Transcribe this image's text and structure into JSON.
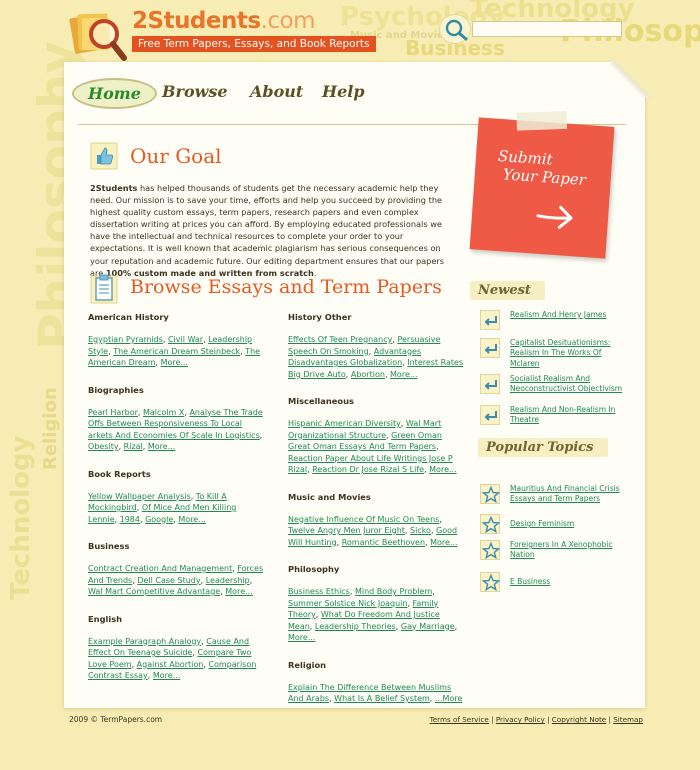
{
  "brand": {
    "name": "2Students",
    "suffix": ".com",
    "tagline": "Free Term Papers, Essays, and Book Reports"
  },
  "search": {
    "value": "",
    "placeholder": ""
  },
  "nav": [
    {
      "label": "Home",
      "active": true
    },
    {
      "label": "Browse"
    },
    {
      "label": "About"
    },
    {
      "label": "Help"
    }
  ],
  "background_words": [
    "Psychology",
    "Technology",
    "Philosophy",
    "Business",
    "Music and Movies",
    "Philosophy",
    "Technology",
    "Religion"
  ],
  "goal": {
    "title": "Our Goal",
    "brand_bold": "2Students",
    "text1": " has helped thousands of students get the necessary academic help they need. Our mission is to save your time, efforts and help you succeed by providing the highest quality custom essays, term papers, research papers and even complex dissertation writing at prices you can afford. By employing educated professionals we have the intellectual and technical resources to complete your order to your expectations. It is well known that academic plagiarism has serious consequences on your reputation and academic future. Our editing department ensures that our papers are ",
    "bold2": "100% custom made and written from scratch",
    "text2": "."
  },
  "browse": {
    "title": "Browse Essays and Term Papers",
    "left": [
      {
        "heading": "American History",
        "links": [
          "Egyptian Pyramids",
          "Civil War",
          "Leadership Style",
          "The American Dream Steinbeck",
          "The American Dream"
        ],
        "more": "More..."
      },
      {
        "heading": "Biographies",
        "links": [
          "Pearl Harbor",
          "Malcolm X",
          "Analyse The Trade Offs Between Responsiveness To Local arkets And Economies Of Scale In Logistics",
          "Obesity",
          "Rizal"
        ],
        "more": "More..."
      },
      {
        "heading": "Book Reports",
        "links": [
          "Yellow Wallpaper Analysis",
          "To Kill A Mockingbird",
          "Of Mice And Men Killing Lennie",
          "1984",
          "Google"
        ],
        "more": "More..."
      },
      {
        "heading": "Business",
        "links": [
          "Contract Creation And Management",
          "Forces And Trends",
          "Dell Case Study",
          "Leadership",
          "Wal Mart Competitive Advantage"
        ],
        "more": "More..."
      },
      {
        "heading": "English",
        "links": [
          "Example Paragraph Analogy",
          "Cause And Effect On Teenage Suicide",
          "Compare Two Love Poem",
          "Against Abortion",
          "Comparison Contrast Essay"
        ],
        "more": "More..."
      }
    ],
    "right": [
      {
        "heading": "History Other",
        "links": [
          "Effects Of Teen Pregnancy",
          "Persuasive Speech On Smoking",
          "Advantages Disadvantages Globalization",
          "Interest Rates Big Drive Auto",
          "Abortion"
        ],
        "more": "More..."
      },
      {
        "heading": "Miscellaneous",
        "links": [
          "Hispanic American Diversity",
          "Wal Mart Organizational Structure",
          "Green Oman Great Oman Essays And Term Papers",
          "Reaction Paper About Life Writings Jose P Rizal",
          "Reaction Dr Jose Rizal S Life"
        ],
        "more": "More..."
      },
      {
        "heading": "Music and Movies",
        "links": [
          "Negative Influence Of Music On Teens",
          "Twelve Angry Men Juror Eight",
          "Sicko",
          "Good Will Hunting",
          "Romantic Beethoven"
        ],
        "more": "More..."
      },
      {
        "heading": "Philosophy",
        "links": [
          "Business Ethics",
          "Mind Body Problem",
          "Summer Solstice Nick Joaquin",
          "Family Theory",
          "What Do Freedom And Justice Mean",
          "Leadership Theories",
          "Gay Marriage"
        ],
        "more": "More..."
      },
      {
        "heading": "Religion",
        "links": [
          "Explain The Difference Between Muslims And Arabs",
          "What Is A Belief System"
        ],
        "more": "...More"
      }
    ]
  },
  "submit": {
    "line1": "Submit",
    "line2": "Your Paper"
  },
  "newest": {
    "title": "Newest",
    "items": [
      "Realism And Henry James",
      "Capitalist Desituationisms: Realism In The Works Of Mclaren",
      "Socialist Realism And Neoconstructivist Objectivism",
      "Realism And Non-Realism In Theatre"
    ]
  },
  "popular": {
    "title": "Popular Topics",
    "items": [
      "Mauritius And Financial Crisis Essays and Term Papers",
      "Design Feminism",
      "Foreigners In A Xenophobic Nation",
      "E Business"
    ]
  },
  "footer": {
    "copyright": "2009 © TermPapers.com",
    "links": [
      "Terms of Service",
      "Privacy Policy",
      "Copyright Note",
      "Sitemap"
    ]
  },
  "colors": {
    "background": "#f7edb4",
    "accent_orange": "#e35a23",
    "link_green": "#1f8a52",
    "sticky_red": "#ee5a45"
  }
}
